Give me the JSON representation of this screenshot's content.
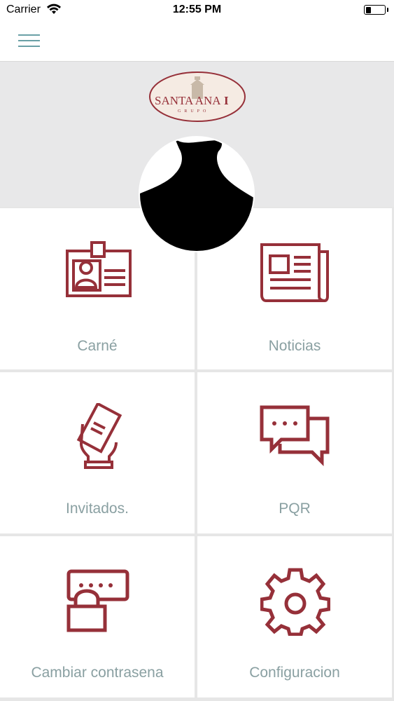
{
  "status_bar": {
    "carrier": "Carrier",
    "time": "12:55 PM"
  },
  "nav": {
    "menu_icon": "hamburger-menu-icon"
  },
  "header": {
    "logo_text_main": "SANTA ANA",
    "logo_text_suffix": "I",
    "logo_subtext": "GRUPO",
    "avatar_icon": "user-silhouette-icon"
  },
  "colors": {
    "accent": "#963039",
    "label": "#8aa0a2",
    "menu": "#6aa0a6",
    "header_bg": "#e8e8e9"
  },
  "menu": [
    {
      "label": "Carné",
      "icon": "id-badge-icon"
    },
    {
      "label": "Noticias",
      "icon": "newspaper-icon"
    },
    {
      "label": "Invitados.",
      "icon": "hand-ticket-icon"
    },
    {
      "label": "PQR",
      "icon": "chat-bubbles-icon"
    },
    {
      "label": "Cambiar contrasena",
      "icon": "password-lock-icon"
    },
    {
      "label": "Configuracion",
      "icon": "gear-icon"
    }
  ]
}
